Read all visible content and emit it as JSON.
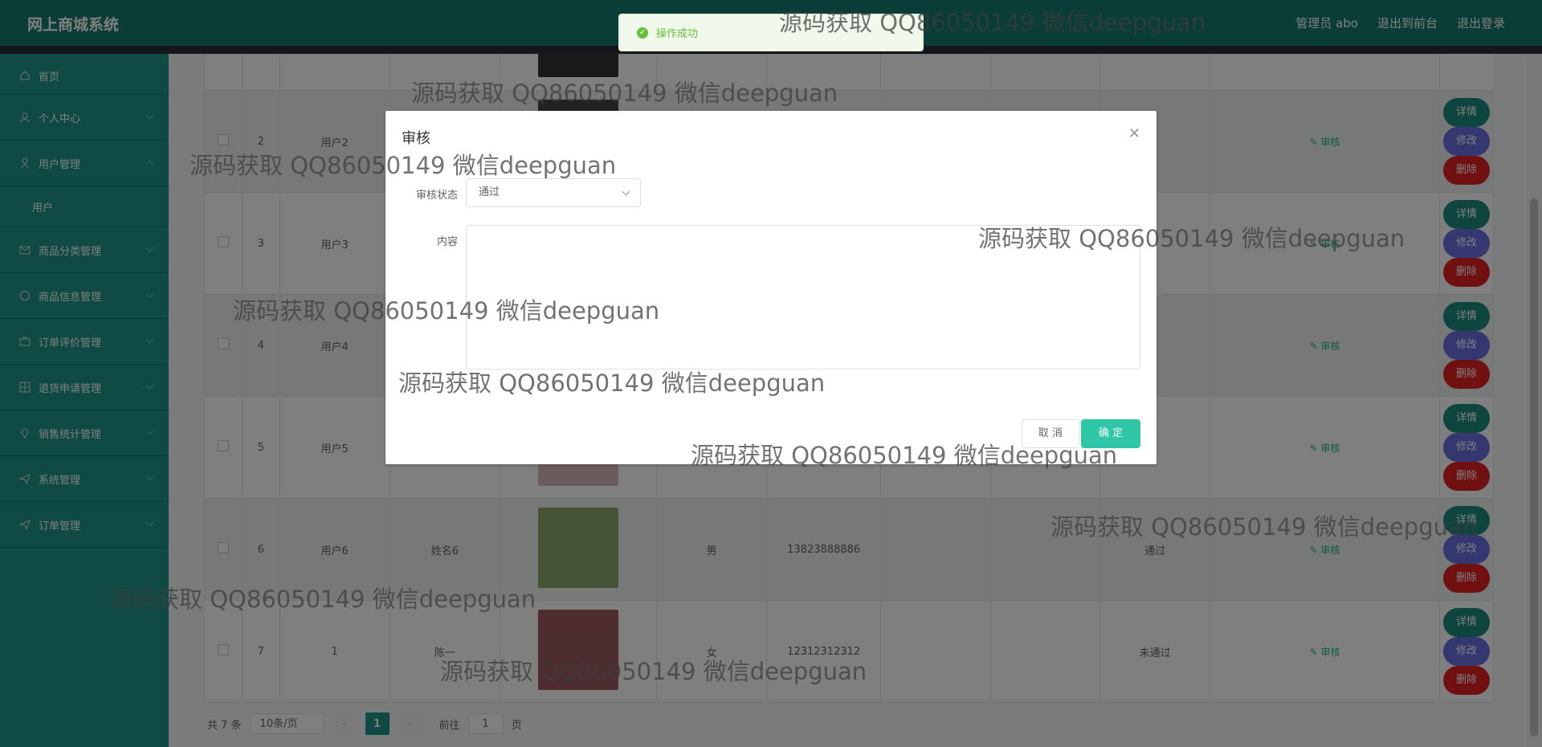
{
  "app": {
    "title": "网上商城系统"
  },
  "header": {
    "admin": "管理员 abo",
    "to_front": "退出到前台",
    "logout": "退出登录"
  },
  "sidebar": {
    "items": [
      {
        "label": "首页"
      },
      {
        "label": "个人中心"
      },
      {
        "label": "用户管理",
        "open": true,
        "children": [
          "用户"
        ]
      },
      {
        "label": "商品分类管理"
      },
      {
        "label": "商品信息管理"
      },
      {
        "label": "订单评价管理"
      },
      {
        "label": "退货申请管理"
      },
      {
        "label": "销售统计管理"
      },
      {
        "label": "系统管理"
      },
      {
        "label": "订单管理"
      }
    ]
  },
  "table": {
    "rows": [
      {
        "id": "2",
        "account": "用户2",
        "name": "",
        "gender": "",
        "phone": "",
        "status": ""
      },
      {
        "id": "3",
        "account": "用户3",
        "name": "",
        "gender": "",
        "phone": "",
        "status": ""
      },
      {
        "id": "4",
        "account": "用户4",
        "name": "",
        "gender": "",
        "phone": "",
        "status": ""
      },
      {
        "id": "5",
        "account": "用户5",
        "name": "",
        "gender": "",
        "phone": "",
        "status": ""
      },
      {
        "id": "6",
        "account": "用户6",
        "name": "姓名6",
        "gender": "男",
        "phone": "13823888886",
        "status": "通过"
      },
      {
        "id": "7",
        "account": "1",
        "name": "陈一",
        "gender": "女",
        "phone": "12312312312",
        "status": "未通过"
      }
    ],
    "audit_label": "审核",
    "detail_label": "详情",
    "edit_label": "修改",
    "delete_label": "删除"
  },
  "pagination": {
    "total": "共 7 条",
    "page_size": "10条/页",
    "current": "1",
    "goto_prefix": "前往",
    "goto_value": "1",
    "goto_suffix": "页"
  },
  "dialog": {
    "title": "审核",
    "status_label": "审核状态",
    "status_value": "通过",
    "content_label": "内容",
    "cancel": "取 消",
    "confirm": "确 定"
  },
  "toast": {
    "message": "操作成功"
  },
  "watermark": "源码获取 QQ86050149 微信deepguan",
  "colors": {
    "brand": "#157b70",
    "sidebar": "#1f9488",
    "detail": "#1f8a7e",
    "edit": "#6a6ee0",
    "delete": "#e02020",
    "confirm": "#2fc7a7",
    "success": "#67c23a"
  }
}
